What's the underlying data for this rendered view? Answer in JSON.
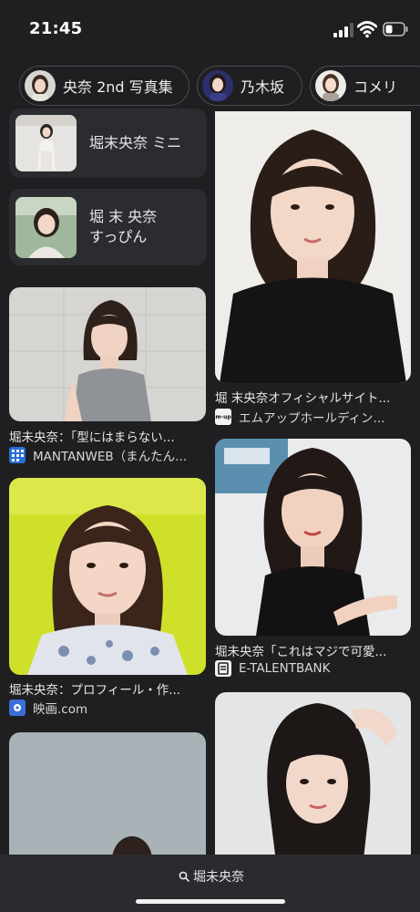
{
  "status": {
    "time": "21:45"
  },
  "chips": [
    {
      "label": "央奈 2nd 写真集"
    },
    {
      "label": "乃木坂"
    },
    {
      "label": "コメリ"
    }
  ],
  "related_searches": [
    {
      "label": "堀末央奈 ミニ"
    },
    {
      "label": "堀 末 央奈\nすっぴん"
    }
  ],
  "results": [
    {
      "caption": "堀 末央奈オフィシャルサイト...",
      "source": "エムアップホールディン...",
      "favicon_text": "m-up"
    },
    {
      "caption": "堀未央奈：「型にはまらない...",
      "source": "MANTANWEB（まんたん..."
    },
    {
      "caption": "堀未央奈「これはマジで可愛...",
      "source": "E-TALENTBANK"
    },
    {
      "caption": "堀未央奈：プロフィール・作...",
      "source": "映画.com"
    }
  ],
  "bottom": {
    "query": "堀未央奈"
  },
  "colors": {
    "background": "#1f1f21",
    "card": "#2b2c2f",
    "chip_border": "#4b4d52",
    "bottom_bar": "#2a2b2e"
  }
}
